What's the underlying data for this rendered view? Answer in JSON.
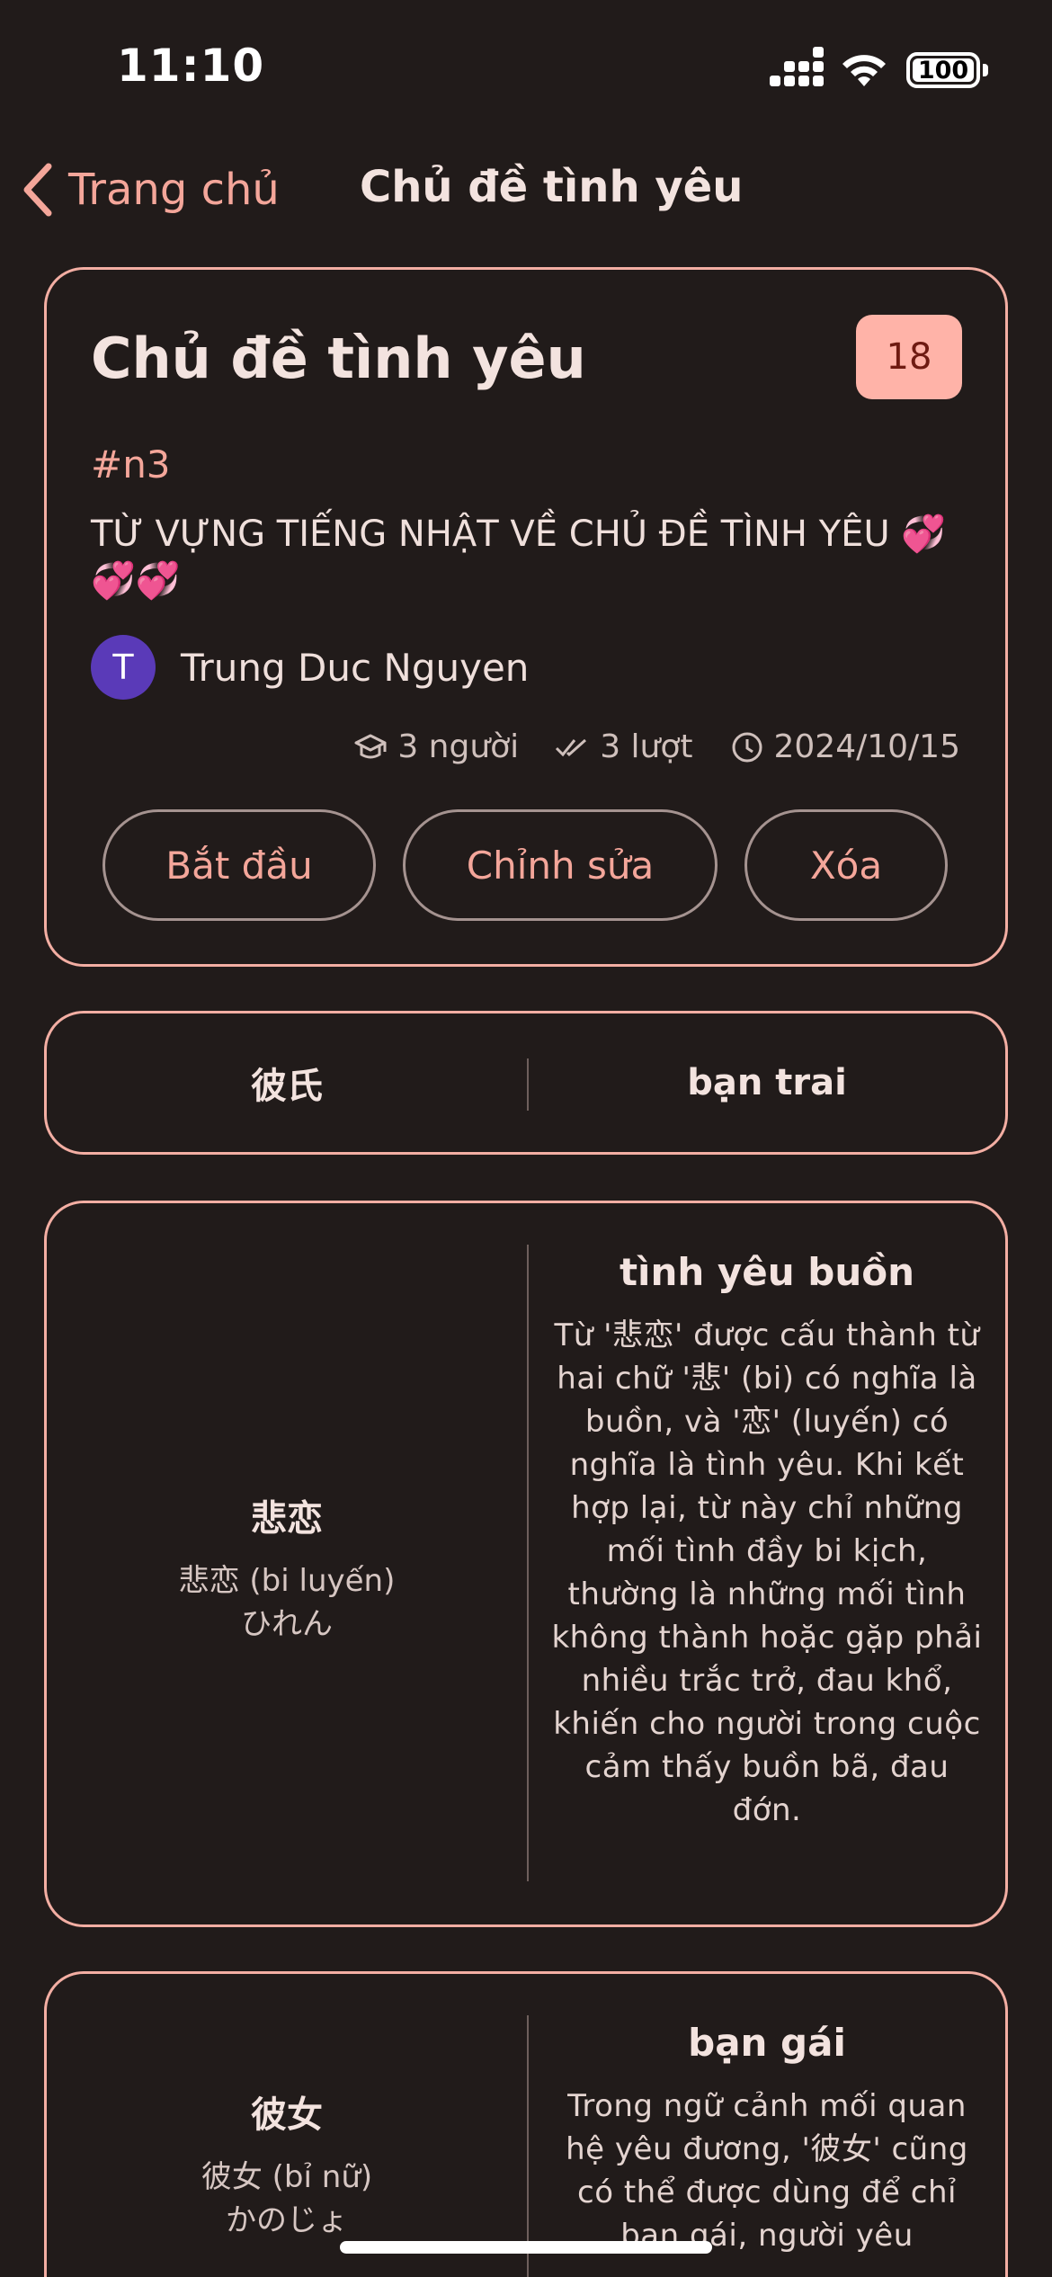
{
  "status": {
    "time": "11:10",
    "battery": "100"
  },
  "nav": {
    "back_label": "Trang chủ",
    "title": "Chủ đề tình yêu"
  },
  "topic": {
    "title": "Chủ đề tình yêu",
    "count": "18",
    "hashtag": "#n3",
    "description": "TỪ VỰNG TIẾNG NHẬT VỀ CHỦ ĐỀ TÌNH YÊU 💞💞💞",
    "author_initial": "T",
    "author_name": "Trung Duc Nguyen",
    "learners": "3 người",
    "attempts": "3 lượt",
    "date": "2024/10/15",
    "actions": {
      "start": "Bắt đầu",
      "edit": "Chỉnh sửa",
      "delete": "Xóa"
    }
  },
  "vocab": [
    {
      "word": "彼氏",
      "meaning": "bạn trai"
    },
    {
      "word": "悲恋",
      "reading_vi": "悲恋 (bi luyến)",
      "reading_kana": "ひれん",
      "meaning": "tình yêu buồn",
      "explanation": "Từ '悲恋' được cấu thành từ hai chữ '悲' (bi) có nghĩa là buồn, và '恋' (luyến) có nghĩa là tình yêu. Khi kết hợp lại, từ này chỉ những mối tình đầy bi kịch, thường là những mối tình không thành hoặc gặp phải nhiều trắc trở, đau khổ, khiến cho người trong cuộc cảm thấy buồn bã, đau đớn."
    },
    {
      "word": "彼女",
      "reading_vi": "彼女 (bỉ nữ)",
      "reading_kana": "かのじょ",
      "meaning": "bạn gái",
      "explanation": "Trong ngữ cảnh mối quan hệ yêu đương, '彼女' cũng có thể được dùng để chỉ bạn gái, người yêu"
    }
  ],
  "colors": {
    "accent": "#f4a69a",
    "background": "#211b1a",
    "badge": "#ffb3a8",
    "avatar": "#5a3ab8"
  }
}
